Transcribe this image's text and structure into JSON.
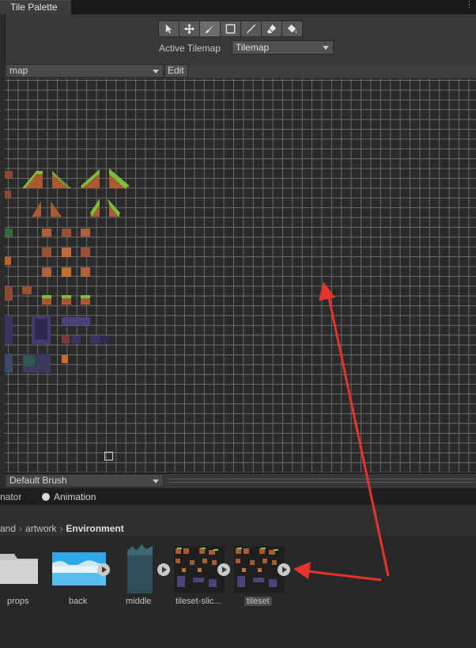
{
  "window": {
    "tab_title": "Tile Palette",
    "menu_glyph": "⋮"
  },
  "toolbar": {
    "tools": [
      "select-icon",
      "move-icon",
      "paintbrush-icon",
      "box-fill-icon",
      "picker-icon",
      "eraser-icon",
      "fill-icon"
    ],
    "active_tool": "paintbrush-icon",
    "active_tilemap_label": "Active Tilemap",
    "active_tilemap_value": "Tilemap"
  },
  "palette": {
    "selected": "map",
    "edit_label": "Edit"
  },
  "brush": {
    "selected": "Default Brush"
  },
  "lower_panel": {
    "tabs": [
      {
        "label": "nator"
      },
      {
        "label": "Animation",
        "icon": "clock-icon"
      }
    ],
    "breadcrumb": [
      "and",
      "artwork",
      "Environment"
    ]
  },
  "assets": [
    {
      "name": "props",
      "kind": "folder"
    },
    {
      "name": "back",
      "kind": "image"
    },
    {
      "name": "middle",
      "kind": "image"
    },
    {
      "name": "tileset-slic...",
      "kind": "image"
    },
    {
      "name": "tileset",
      "kind": "image",
      "selected": true
    }
  ],
  "colors": {
    "annotation_arrow": "#e8322c",
    "grid_line": "#6a6a6a",
    "tile_dirt": "#a85a32",
    "tile_grass": "#7ac03a",
    "tile_purple": "#3a3460"
  }
}
